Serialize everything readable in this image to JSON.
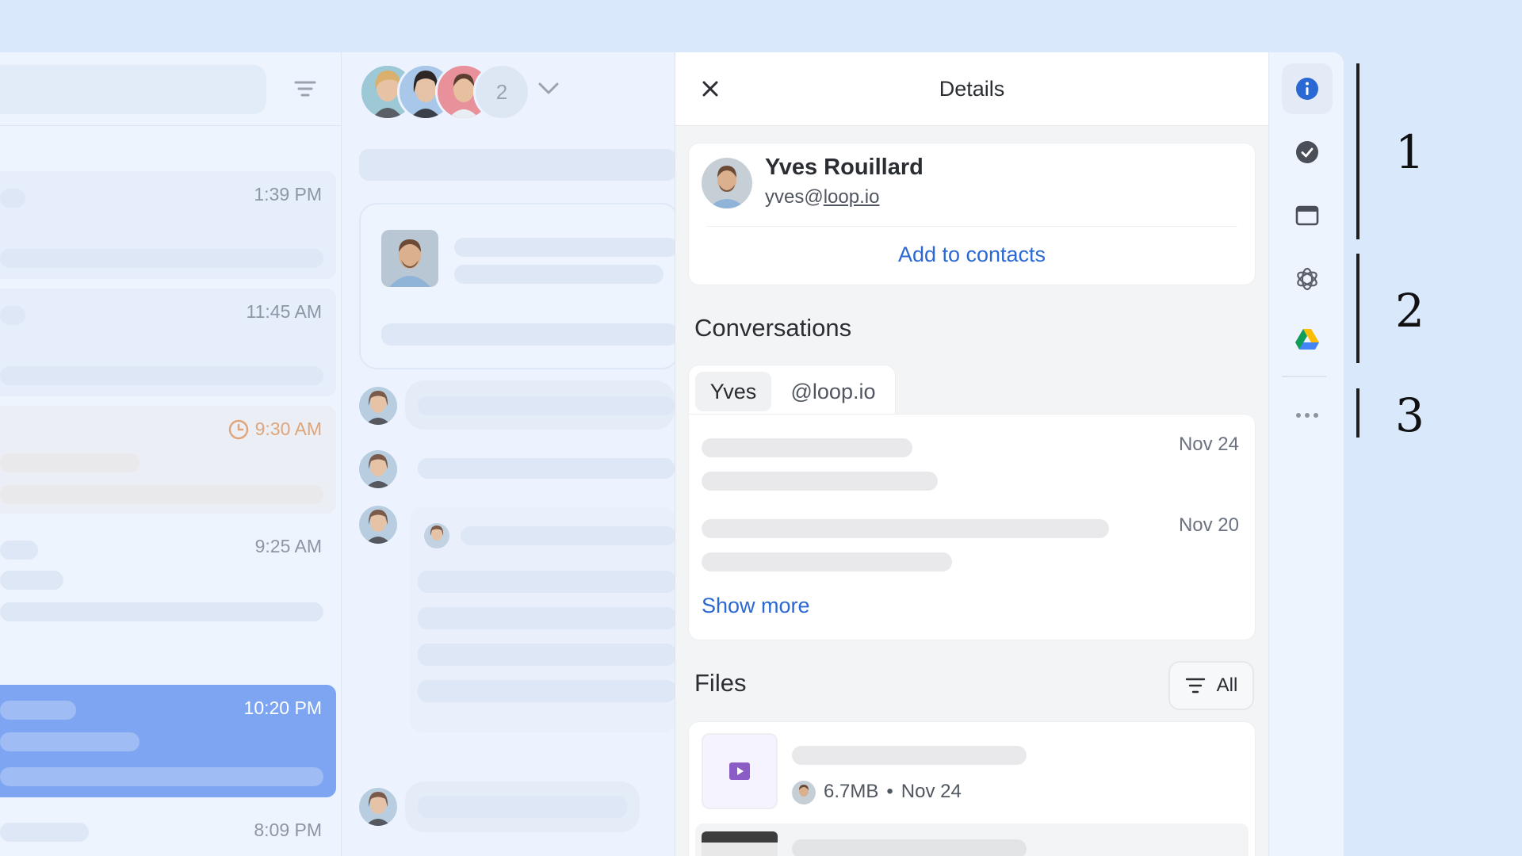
{
  "conversation_list": {
    "rows": [
      {
        "time": "1:39 PM"
      },
      {
        "time": "11:45 AM"
      },
      {
        "time": "9:30 AM",
        "scheduled": true
      },
      {
        "time": "9:25 AM"
      },
      {
        "time": "10:20 PM",
        "selected": true
      },
      {
        "time": "8:09 PM"
      }
    ]
  },
  "thread": {
    "participants_extra_count": "2"
  },
  "details": {
    "title": "Details",
    "contact": {
      "name": "Yves Rouillard",
      "email_user": "yves@",
      "email_domain": "loop.io",
      "add_to_contacts": "Add to contacts"
    },
    "conversations": {
      "heading": "Conversations",
      "tabs": [
        {
          "label": "Yves",
          "active": true
        },
        {
          "label": "@loop.io",
          "active": false
        }
      ],
      "items": [
        {
          "date": "Nov 24"
        },
        {
          "date": "Nov 20"
        }
      ],
      "show_more": "Show more"
    },
    "files": {
      "heading": "Files",
      "filter_label": "All",
      "items": [
        {
          "size": "6.7MB",
          "separator": "•",
          "date": "Nov 24",
          "type_icon": "video-file-icon"
        }
      ]
    }
  },
  "rail": {
    "items": [
      "info-icon",
      "check-circle-icon",
      "browser-window-icon",
      "openai-icon",
      "google-drive-icon",
      "more-horizontal-icon"
    ]
  },
  "annotations": [
    "1",
    "2",
    "3"
  ],
  "colors": {
    "accent": "#2a68d3",
    "selected_row": "#7da5f1",
    "scheduled": "#e0a47a"
  }
}
